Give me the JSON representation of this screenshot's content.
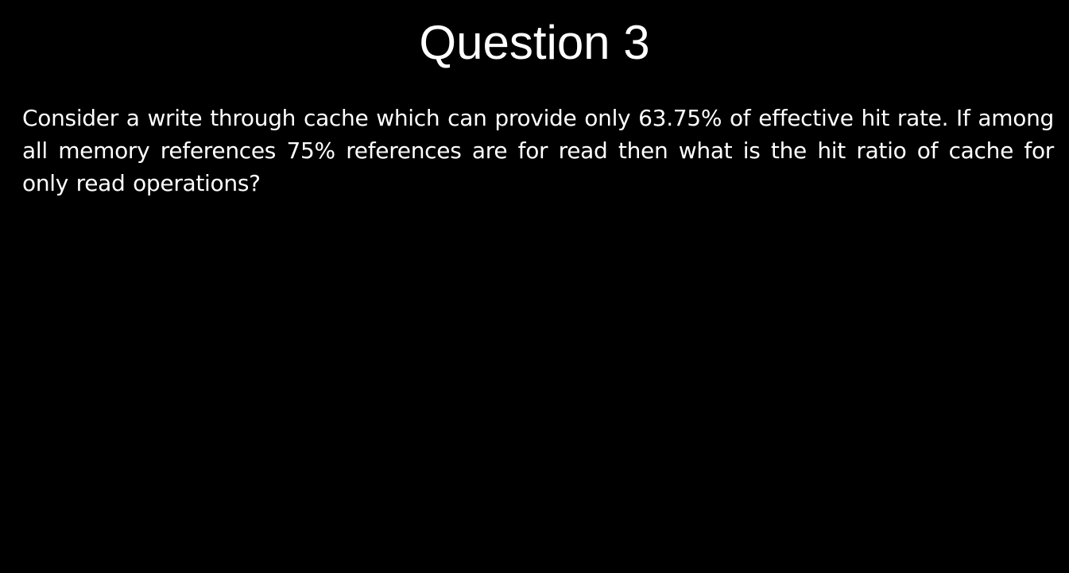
{
  "slide": {
    "title": "Question 3",
    "body": "Consider a write through cache which can provide only 63.75% of effective hit rate. If among all memory references 75% references are for read then what is the hit ratio of cache for only read operations?"
  },
  "colors": {
    "background": "#000000",
    "text": "#ffffff"
  }
}
